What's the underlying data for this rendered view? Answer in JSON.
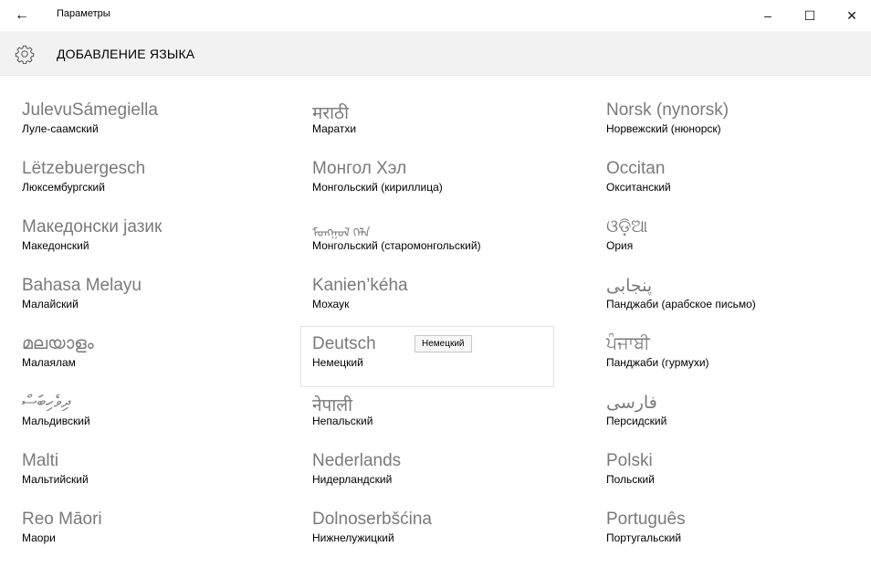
{
  "window": {
    "back_label": "←",
    "title": "Параметры",
    "minimize_label": "–",
    "maximize_label": "☐",
    "close_label": "✕"
  },
  "header": {
    "icon": "gear-icon",
    "title": "ДОБАВЛЕНИЕ ЯЗЫКА"
  },
  "columns": [
    [
      {
        "native": "JulevuSámegiella",
        "russian": "Луле-саамский"
      },
      {
        "native": "Lëtzebuergesch",
        "russian": "Люксембургский"
      },
      {
        "native": "Македонски јазик",
        "russian": "Македонский"
      },
      {
        "native": "Bahasa Melayu",
        "russian": "Малайский"
      },
      {
        "native": "മലയാളം",
        "russian": "Малаялам"
      },
      {
        "native": "ދިވެހިބަސް",
        "russian": "Мальдивский"
      },
      {
        "native": "Malti",
        "russian": "Мальтийский"
      },
      {
        "native": "Reo Māori",
        "russian": "Маори"
      }
    ],
    [
      {
        "native": "मराठी",
        "russian": "Маратхи"
      },
      {
        "native": "Монгол Хэл",
        "russian": "Монгольский (кириллица)"
      },
      {
        "native": "ᠮᠣᠩᠭᠣᠯ ᠬᠡᠯᠡ",
        "russian": "Монгольский (старомонгольский)"
      },
      {
        "native": "Kanien’kéha",
        "russian": "Мохаук"
      },
      {
        "native": "Deutsch",
        "russian": "Немецкий",
        "tooltip": "Немецкий"
      },
      {
        "native": "नेपाली",
        "russian": "Непальский"
      },
      {
        "native": "Nederlands",
        "russian": "Нидерландский"
      },
      {
        "native": "Dolnoserbšćina",
        "russian": "Нижнелужицкий"
      }
    ],
    [
      {
        "native": "Norsk (nynorsk)",
        "russian": "Норвежский (нюнорск)"
      },
      {
        "native": "Occitan",
        "russian": "Окситанский"
      },
      {
        "native": "ଓଡ଼ିଆ",
        "russian": "Ория"
      },
      {
        "native": "پنجابی",
        "russian": "Панджаби (арабское письмо)"
      },
      {
        "native": "ਪੰਜਾਬੀ",
        "russian": "Панджаби (гурмухи)"
      },
      {
        "native": "فارسی",
        "russian": "Персидский"
      },
      {
        "native": "Polski",
        "russian": "Польский"
      },
      {
        "native": "Português",
        "russian": "Португальский"
      }
    ]
  ],
  "colors": {
    "native_text": "#7a7a7a",
    "header_bg": "#f2f2f2"
  }
}
